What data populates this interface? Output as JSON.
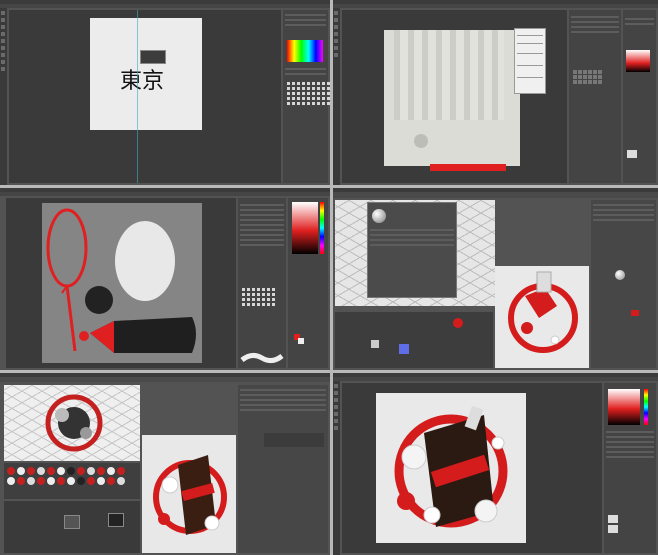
{
  "screens": {
    "p1": {
      "document_text": "東京"
    },
    "p2": {},
    "p3": {},
    "p4": {},
    "p5": {},
    "p6": {}
  },
  "colors": {
    "accent": "#e02020",
    "panel": "#535353",
    "canvas_bg": "#3a3a3a",
    "paper": "#ececec"
  }
}
